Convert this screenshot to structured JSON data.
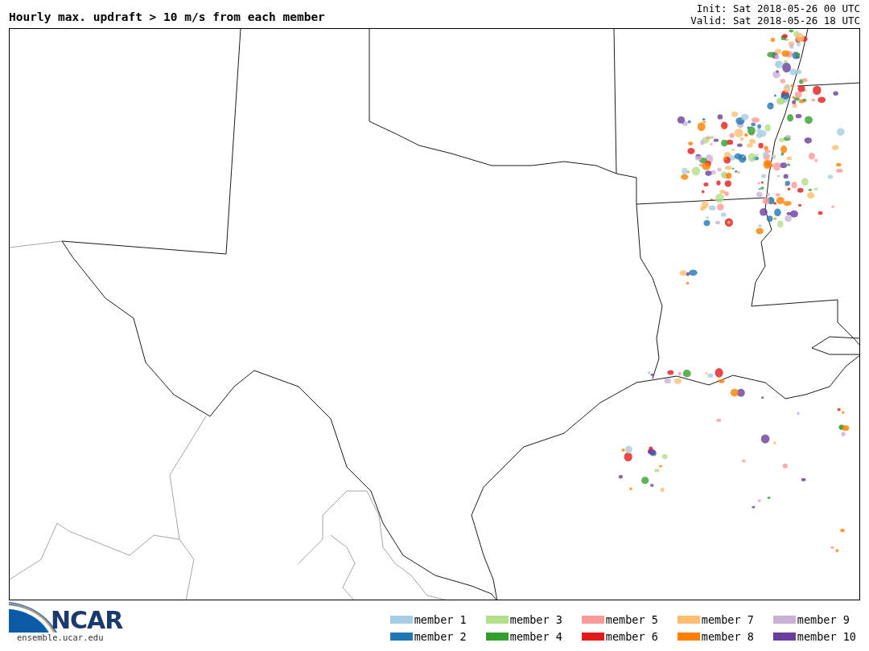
{
  "header": {
    "title": "Hourly max. updraft > 10 m/s from each member",
    "init": "Init: Sat 2018-05-26 00 UTC",
    "valid": "Valid: Sat 2018-05-26 18 UTC"
  },
  "logo": {
    "wordmark": "NCAR",
    "url": "ensemble.ucar.edu"
  },
  "legend": [
    {
      "label": "member 1",
      "color": "#a6cee3"
    },
    {
      "label": "member 2",
      "color": "#1f78b4"
    },
    {
      "label": "member 3",
      "color": "#b2df8a"
    },
    {
      "label": "member 4",
      "color": "#33a02c"
    },
    {
      "label": "member 5",
      "color": "#fb9a99"
    },
    {
      "label": "member 6",
      "color": "#e31a1c"
    },
    {
      "label": "member 7",
      "color": "#fdbf6f"
    },
    {
      "label": "member 8",
      "color": "#ff7f00"
    },
    {
      "label": "member 9",
      "color": "#cab2d6"
    },
    {
      "label": "member 10",
      "color": "#6a3d9a"
    }
  ]
}
